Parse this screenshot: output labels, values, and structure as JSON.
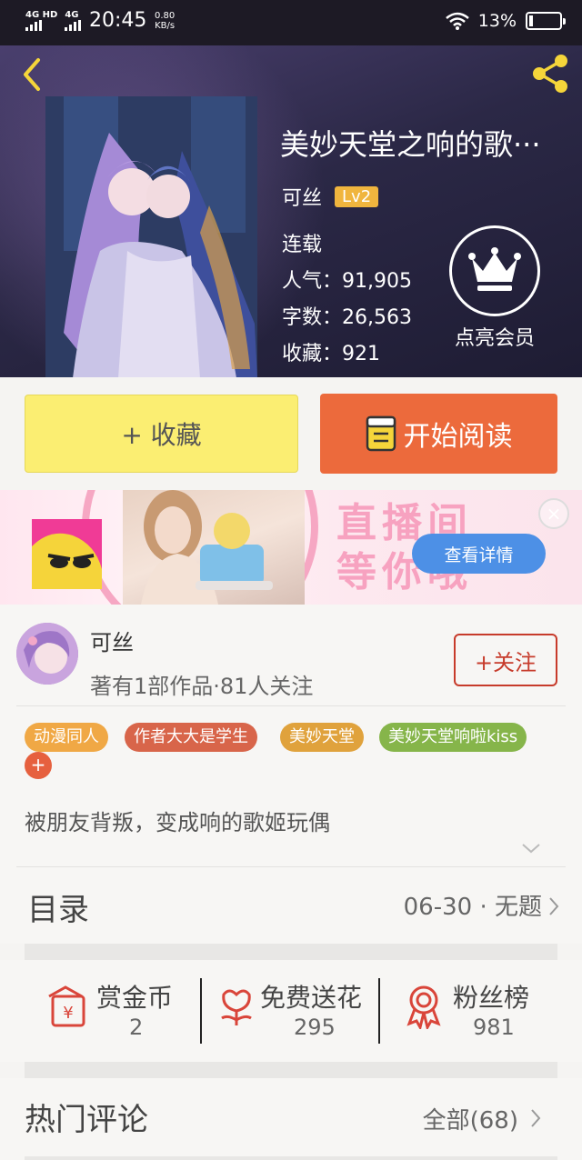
{
  "status_bar": {
    "network_1": "4G HD",
    "network_2": "4G",
    "time": "20:45",
    "speed_value": "0.80",
    "speed_unit": "KB/s",
    "battery": "13%"
  },
  "book": {
    "title": "美妙天堂之响的歌···",
    "author": "可丝",
    "author_level": "Lv2",
    "status": "连载",
    "popularity": "人气：91,905",
    "word_count": "字数：26,563",
    "favorites": "收藏：921"
  },
  "vip": {
    "label": "点亮会员"
  },
  "actions": {
    "collect_label": "+ 收藏",
    "read_label": "开始阅读"
  },
  "ad": {
    "text_lines": [
      "直播间",
      "等你哦"
    ],
    "detail_label": "查看详情",
    "close_icon": "×"
  },
  "author_card": {
    "name": "可丝",
    "stats": "著有1部作品·81人关注",
    "follow_label": "+关注"
  },
  "tags": [
    {
      "label": "动漫同人",
      "color": "#f0a845"
    },
    {
      "label": "作者大大是学生",
      "color": "#d8654a"
    },
    {
      "label": "美妙天堂",
      "color": "#e0a23c"
    },
    {
      "label": "美妙天堂响啦kiss",
      "color": "#86b54a"
    }
  ],
  "tag_add": "+",
  "description": "被朋友背叛，变成响的歌姬玩偶",
  "toc": {
    "title": "目录",
    "latest": "06-30 · 无题"
  },
  "stats": [
    {
      "label": "赏金币",
      "value": "2",
      "icon": "coin-envelope-icon"
    },
    {
      "label": "免费送花",
      "value": "295",
      "icon": "flower-icon"
    },
    {
      "label": "粉丝榜",
      "value": "981",
      "icon": "medal-icon"
    }
  ],
  "comments": {
    "title": "热门评论",
    "all_label": "全部(68)"
  },
  "colors": {
    "accent_orange": "#ec6a3c",
    "collect_yellow": "#fbee72",
    "follow_red": "#c73b2b",
    "icon_yellow": "#f5d53a"
  }
}
